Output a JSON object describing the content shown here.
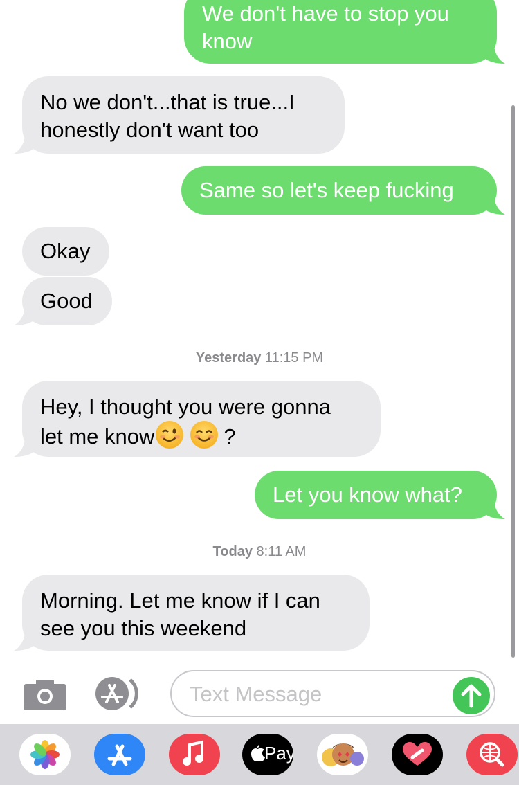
{
  "messages": [
    {
      "id": "m1",
      "dir": "sent",
      "text": "We don't have to stop you know"
    },
    {
      "id": "m2",
      "dir": "received",
      "text": "No we don't...that is true...I honestly don't want too"
    },
    {
      "id": "m3",
      "dir": "sent",
      "text": "Same so let's keep fucking"
    },
    {
      "id": "m4",
      "dir": "received",
      "text": "Okay"
    },
    {
      "id": "m5",
      "dir": "received",
      "text": "Good"
    },
    {
      "id": "m6",
      "dir": "received",
      "text": "Hey, I thought you were gonna let me know 😉 😊 ?"
    },
    {
      "id": "m7",
      "dir": "sent",
      "text": "Let you know what?"
    },
    {
      "id": "m8",
      "dir": "received",
      "text": "Morning. Let me know if I can see you this weekend"
    }
  ],
  "m1": {
    "line1": "We don't have to stop you",
    "line2": "know"
  },
  "m2": {
    "line1": "No we don't...that is true...I",
    "line2": "honestly don't want too"
  },
  "m3": {
    "line1": "Same so let's keep fucking"
  },
  "m4": {
    "line1": "Okay"
  },
  "m5": {
    "line1": "Good"
  },
  "m6": {
    "line1": "Hey, I thought you were gonna",
    "line2_prefix": "let me know",
    "line2_suffix": "?"
  },
  "m7": {
    "line1": "Let you know what?"
  },
  "m8": {
    "line1": "Morning. Let me know if I can",
    "line2": "see you this weekend"
  },
  "timestamps": [
    {
      "day": "Yesterday",
      "time": "11:15 PM"
    },
    {
      "day": "Today",
      "time": "8:11 AM"
    }
  ],
  "input": {
    "placeholder": "Text Message"
  },
  "dock": {
    "apps": [
      {
        "name": "photos-app",
        "icon": "photos-icon"
      },
      {
        "name": "app-store-app",
        "icon": "app-store-icon"
      },
      {
        "name": "music-app",
        "icon": "music-icon"
      },
      {
        "name": "apple-pay-app",
        "icon": "apple-pay-icon",
        "label": "Pay"
      },
      {
        "name": "memoji-app",
        "icon": "memoji-icon"
      },
      {
        "name": "digital-touch-app",
        "icon": "heart-icon"
      },
      {
        "name": "images-search-app",
        "icon": "globe-search-icon"
      }
    ]
  },
  "colors": {
    "sent_bubble": "#6cdc6f",
    "received_bubble": "#e9e9eb",
    "timestamp": "#8a8a8e",
    "send_button": "#43c657",
    "dock_background": "#d8d8dc"
  }
}
